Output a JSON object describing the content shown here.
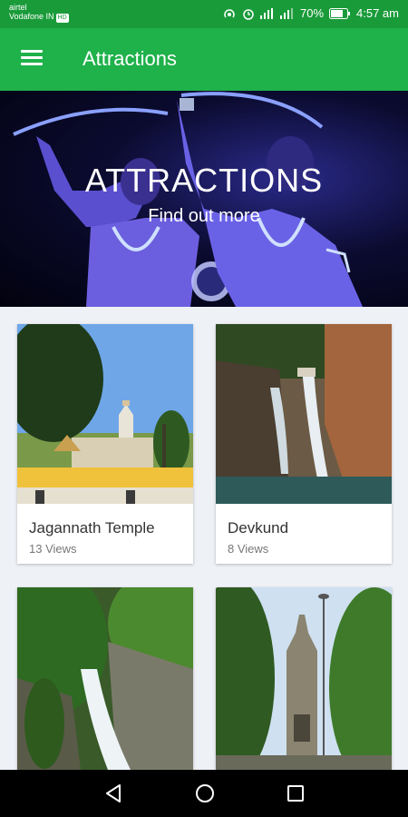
{
  "status_bar": {
    "carrier_1": "airtel",
    "carrier_2": "Vodafone IN",
    "carrier_2_tag": "HD",
    "battery": "70%",
    "time": "4:57 am"
  },
  "app_bar": {
    "title": "Attractions",
    "menu_icon": "hamburger-menu-icon",
    "color": "#1fb14a"
  },
  "hero": {
    "title": "ATTRACTIONS",
    "subtitle": "Find out more"
  },
  "attractions": [
    {
      "name": "Jagannath Temple",
      "views": "13 Views"
    },
    {
      "name": "Devkund",
      "views": "8 Views"
    },
    {
      "name": "",
      "views": ""
    },
    {
      "name": "",
      "views": ""
    }
  ],
  "nav_bar": {
    "back": "back-icon",
    "home": "home-icon",
    "recents": "recents-icon"
  }
}
